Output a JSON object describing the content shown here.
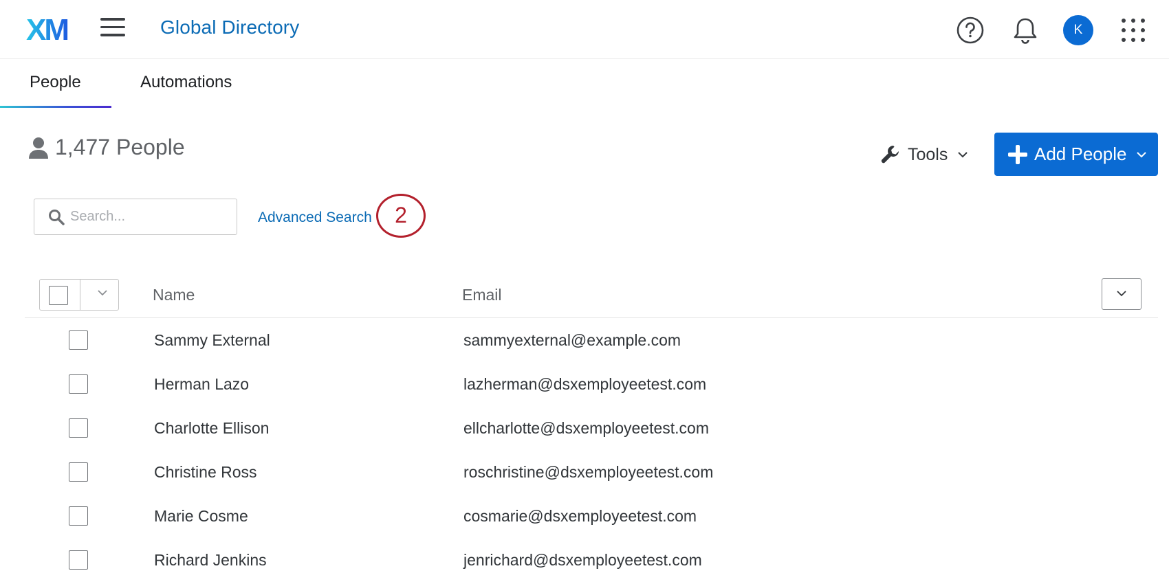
{
  "header": {
    "logo_text": "XM",
    "app_title": "Global Directory",
    "avatar_initial": "K",
    "icons": [
      "hamburger-menu-icon",
      "help-icon",
      "bell-icon",
      "apps-grid-icon"
    ],
    "brand_colors": {
      "logo_gradient_start": "#27c4e8",
      "logo_gradient_end": "#1d5be0",
      "link": "#0b6bb5",
      "primary": "#0b6bd3"
    }
  },
  "tabs": [
    {
      "label": "People",
      "active": true
    },
    {
      "label": "Automations",
      "active": false
    }
  ],
  "summary": {
    "count_text": "1,477 People",
    "icon": "person-icon"
  },
  "actions": {
    "tools_label": "Tools",
    "add_label": "Add People"
  },
  "search": {
    "placeholder": "Search...",
    "value": "",
    "advanced_label": "Advanced Search"
  },
  "annotation": {
    "step_number": "2",
    "color": "#b3202c"
  },
  "table": {
    "columns": [
      "Name",
      "Email"
    ],
    "rows": [
      {
        "name": "Sammy External",
        "email": "sammyexternal@example.com",
        "checked": false
      },
      {
        "name": "Herman Lazo",
        "email": "lazherman@dsxemployeetest.com",
        "checked": false
      },
      {
        "name": "Charlotte Ellison",
        "email": "ellcharlotte@dsxemployeetest.com",
        "checked": false
      },
      {
        "name": "Christine Ross",
        "email": "roschristine@dsxemployeetest.com",
        "checked": false
      },
      {
        "name": "Marie Cosme",
        "email": "cosmarie@dsxemployeetest.com",
        "checked": false
      },
      {
        "name": "Richard Jenkins",
        "email": "jenrichard@dsxemployeetest.com",
        "checked": false
      }
    ]
  }
}
